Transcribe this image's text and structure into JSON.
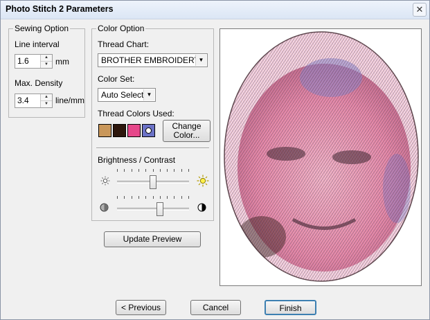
{
  "window": {
    "title": "Photo Stitch 2 Parameters",
    "close_glyph": "✕"
  },
  "sewing_option": {
    "legend": "Sewing Option",
    "line_interval": {
      "label": "Line interval",
      "value": "1.6",
      "unit": "mm"
    },
    "max_density": {
      "label": "Max. Density",
      "value": "3.4",
      "unit": "line/mm"
    }
  },
  "color_option": {
    "legend": "Color Option",
    "thread_chart": {
      "label": "Thread Chart:",
      "value": "BROTHER EMBROIDERY"
    },
    "color_set": {
      "label": "Color Set:",
      "value": "Auto Select"
    },
    "thread_colors": {
      "label": "Thread Colors Used:",
      "swatches": [
        "#c9975a",
        "#2d170d",
        "#e6478a",
        "#6b72c6"
      ],
      "change_button": "Change\nColor..."
    },
    "brightness_contrast": {
      "label": "Brightness / Contrast",
      "brightness_level": 0.5,
      "contrast_level": 0.6
    }
  },
  "buttons": {
    "update_preview": "Update Preview",
    "previous": "< Previous",
    "cancel": "Cancel",
    "finish": "Finish"
  },
  "icons": {
    "brightness_low": "sun-dim-icon",
    "brightness_high": "sun-bright-icon",
    "contrast_low": "contrast-low-icon",
    "contrast_high": "contrast-high-icon"
  },
  "preview": {
    "stitch_colors": [
      "#e6478a",
      "#2d170d",
      "#6b72c6",
      "#c9975a"
    ]
  }
}
